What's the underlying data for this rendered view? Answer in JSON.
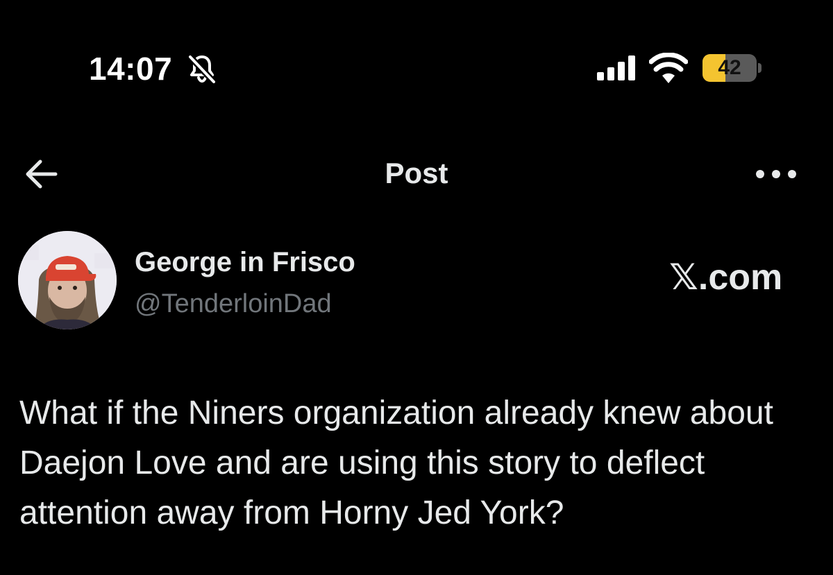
{
  "status_bar": {
    "time": "14:07",
    "bell_icon": "bell-slash-icon",
    "signal_icon": "cellular-signal-icon",
    "wifi_icon": "wifi-icon",
    "battery_level": "42",
    "battery_fraction": 0.42,
    "battery_color": "#f4c430"
  },
  "nav": {
    "back_icon": "arrow-left-icon",
    "title": "Post",
    "more_icon": "more-horizontal-icon"
  },
  "post": {
    "author_name": "George in Frisco",
    "author_handle": "@TenderloinDad",
    "source_watermark": "𝕏.com",
    "text": "What if the Niners organization already knew about Daejon Love and are using this story to deflect attention away from Horny Jed York?"
  },
  "colors": {
    "background": "#000000",
    "primary_text": "#e7e9ea",
    "secondary_text": "#71767b"
  }
}
